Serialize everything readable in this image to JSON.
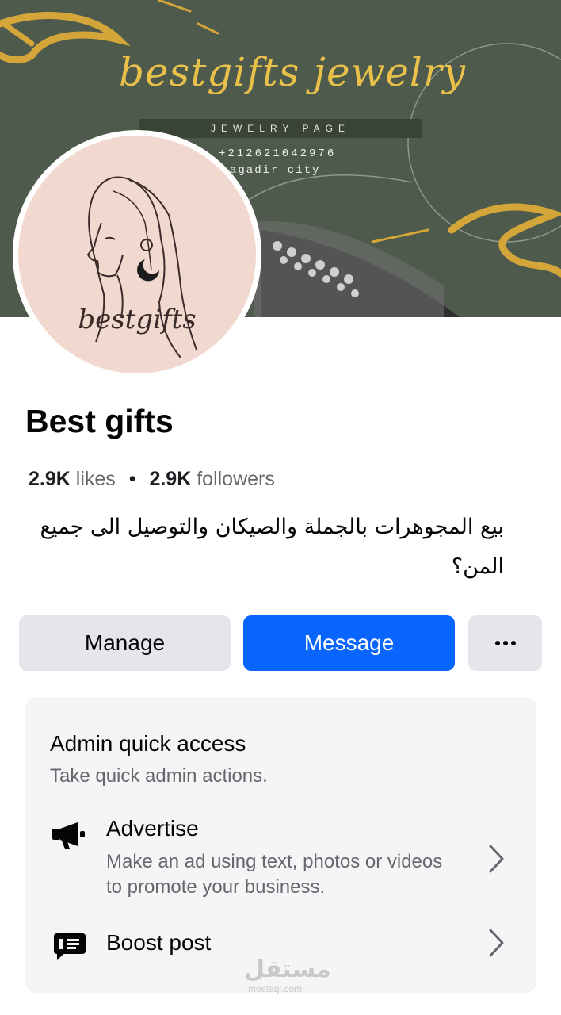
{
  "cover": {
    "brand_script": "bestgifts jewelry",
    "band_text": "JEWELRY PAGE",
    "phone": "+212621042976",
    "city": "agadir city"
  },
  "avatar": {
    "logo_text": "bestgifts"
  },
  "profile": {
    "name": "Best gifts",
    "likes_count": "2.9K",
    "likes_label": "likes",
    "separator": "•",
    "followers_count": "2.9K",
    "followers_label": "followers",
    "bio": "بيع المجوهرات بالجملة والصيكان والتوصيل الى جميع المن؟"
  },
  "actions": {
    "manage_label": "Manage",
    "message_label": "Message",
    "more_icon": "more-dots-icon"
  },
  "admin_card": {
    "title": "Admin quick access",
    "subtitle": "Take quick admin actions.",
    "items": [
      {
        "icon": "megaphone-icon",
        "title": "Advertise",
        "description": "Make an ad using text, photos or videos to promote your business."
      },
      {
        "icon": "boost-post-icon",
        "title": "Boost post",
        "description": ""
      }
    ]
  },
  "watermark": {
    "text": "مستقل",
    "sub": "mostaql.com"
  },
  "colors": {
    "primary": "#0866ff",
    "secondary_button": "#e4e6eb",
    "card_bg": "#f4f5f7",
    "cover_green": "#4e5a4c",
    "gold": "#e9c14a"
  }
}
